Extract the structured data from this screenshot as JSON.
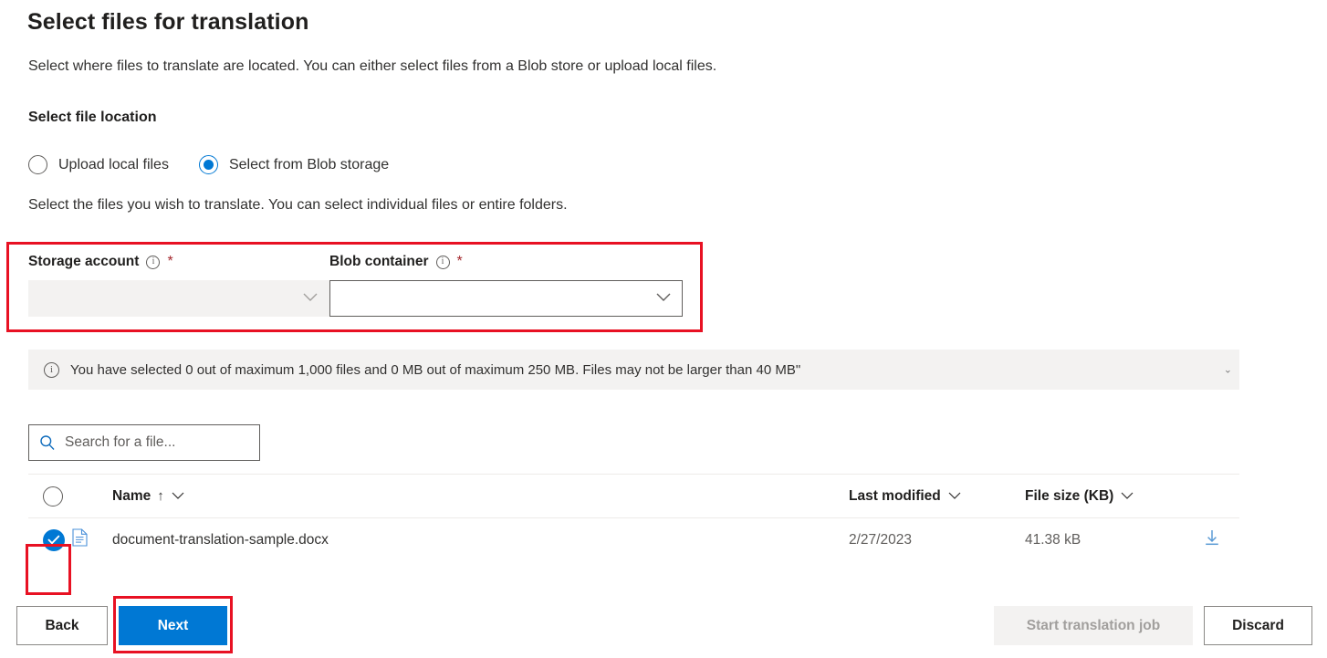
{
  "page": {
    "title": "Select files for translation",
    "intro": "Select where files to translate are located. You can either select files from a Blob store or upload local files.",
    "section_label": "Select file location",
    "helper": "Select the files you wish to translate. You can select individual files or entire folders."
  },
  "file_location": {
    "options": [
      {
        "label": "Upload local files",
        "selected": false
      },
      {
        "label": "Select from Blob storage",
        "selected": true
      }
    ]
  },
  "fields": {
    "storage_account": {
      "label": "Storage account",
      "required_marker": "*",
      "info_glyph": "i",
      "value": "",
      "disabled": true
    },
    "blob_container": {
      "label": "Blob container",
      "required_marker": "*",
      "info_glyph": "i",
      "value": "",
      "disabled": false
    }
  },
  "info_bar": {
    "glyph": "i",
    "message": "You have selected 0 out of maximum 1,000 files and 0 MB out of maximum 250 MB. Files may not be larger than 40 MB\"",
    "collapse_glyph": "⌄"
  },
  "search": {
    "placeholder": "Search for a file...",
    "value": ""
  },
  "table": {
    "columns": [
      {
        "label": "Name",
        "sort": "↑",
        "has_menu": true
      },
      {
        "label": "Last modified",
        "sort": "",
        "has_menu": true
      },
      {
        "label": "File size (KB)",
        "sort": "",
        "has_menu": true
      }
    ],
    "select_all_checked": false,
    "rows": [
      {
        "checked": true,
        "name": "document-translation-sample.docx",
        "last_modified": "2/27/2023",
        "file_size": "41.38 kB",
        "download": "download-icon"
      }
    ]
  },
  "footer": {
    "back": "Back",
    "next": "Next",
    "start": "Start translation job",
    "discard": "Discard"
  },
  "colors": {
    "accent": "#0078d4",
    "annotation": "#e81123",
    "required": "#a4262c",
    "disabled_bg": "#f3f2f1"
  }
}
